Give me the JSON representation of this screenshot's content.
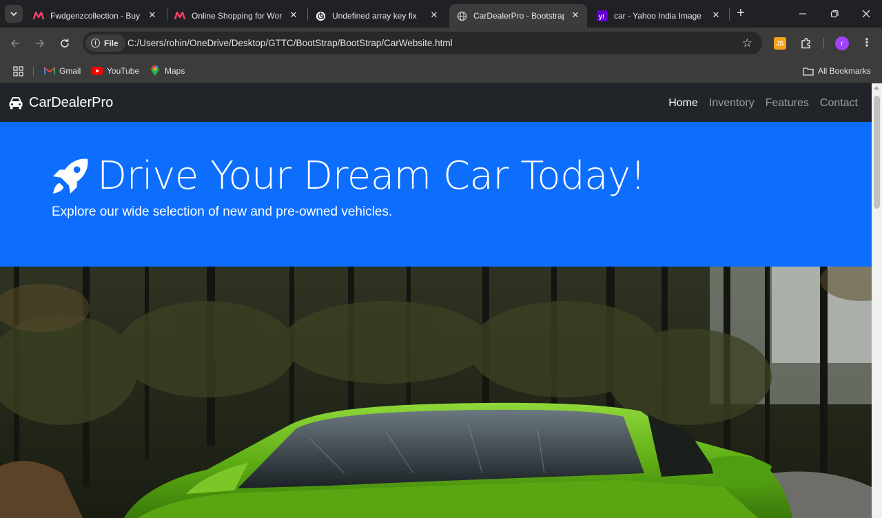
{
  "browser": {
    "tabs": [
      {
        "title": "Fwdgenzcollection - Buy",
        "favicon": "myntra-icon"
      },
      {
        "title": "Online Shopping for Wor",
        "favicon": "myntra-icon"
      },
      {
        "title": "Undefined array key fix",
        "favicon": "chatgpt-icon"
      },
      {
        "title": "CarDealerPro - Bootstrap",
        "favicon": "globe-icon",
        "active": true
      },
      {
        "title": "car - Yahoo India Image",
        "favicon": "yahoo-icon"
      }
    ],
    "omnibox": {
      "chip_label": "File",
      "url": "C:/Users/rohin/OneDrive/Desktop/GTTC/BootStrap/BootStrap/CarWebsite.html"
    },
    "extension_js_label": "JS",
    "avatar_letter": "r",
    "bookmarks": [
      {
        "label": "Gmail",
        "icon": "gmail-icon"
      },
      {
        "label": "YouTube",
        "icon": "youtube-icon"
      },
      {
        "label": "Maps",
        "icon": "maps-icon"
      }
    ],
    "all_bookmarks_label": "All Bookmarks"
  },
  "page": {
    "brand": "CarDealerPro",
    "nav": [
      "Home",
      "Inventory",
      "Features",
      "Contact"
    ],
    "active_nav": "Home",
    "hero_title": "Drive Your Dream Car Today!",
    "hero_subtitle": "Explore our wide selection of new and pre-owned vehicles.",
    "colors": {
      "navbar": "#212529",
      "hero": "#0d6efd",
      "car_body": "#6fbf1e"
    }
  }
}
